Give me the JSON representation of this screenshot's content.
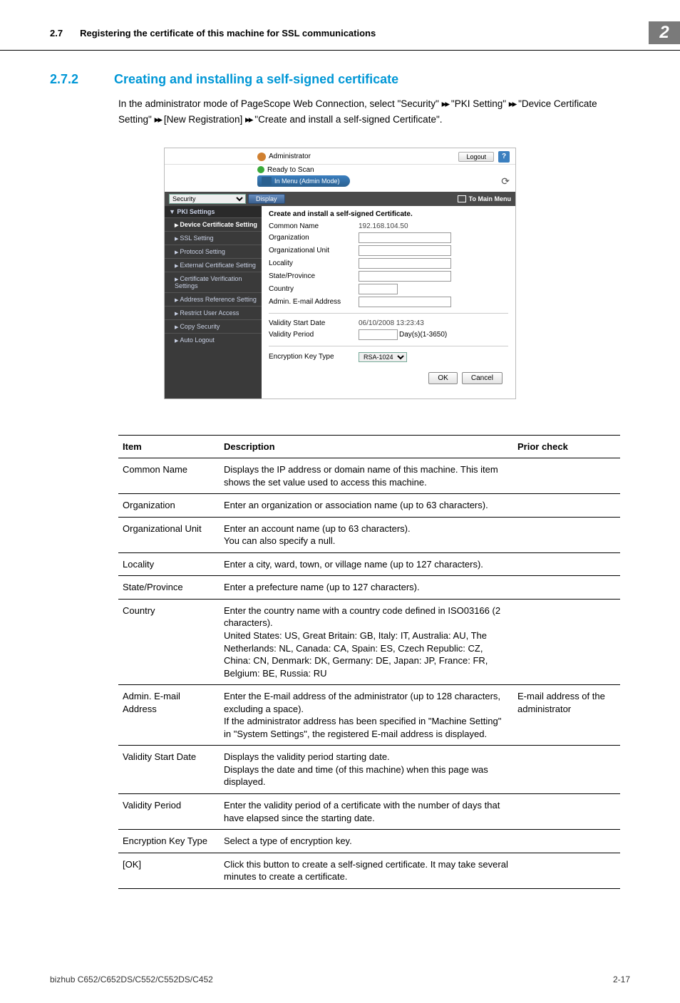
{
  "header": {
    "section_num": "2.7",
    "section_title": "Registering the certificate of this machine for SSL communications",
    "chip": "2"
  },
  "heading": {
    "num": "2.7.2",
    "title": "Creating and installing a self-signed certificate"
  },
  "intro": {
    "l1a": "In the administrator mode of PageScope Web Connection, select \"Security\" ",
    "l1b": " \"PKI Setting\" ",
    "l1c": " \"Device Certificate Setting\" ",
    "l1d": " [New Registration] ",
    "l1e": " \"Create and install a self-signed Certificate\"."
  },
  "ss": {
    "admin": "Administrator",
    "logout": "Logout",
    "help": "?",
    "ready": "Ready to Scan",
    "mode": "In Menu (Admin Mode)",
    "refresh": "⟳",
    "select": "Security",
    "display": "Display",
    "mainmenu": "To Main Menu",
    "side": {
      "g1": "▼ PKI Settings",
      "i1": "Device Certificate Setting",
      "i2": "SSL Setting",
      "i3": "Protocol Setting",
      "i4": "External Certificate Setting",
      "g2": "Certificate Verification Settings",
      "g3": "Address Reference Setting",
      "g4": "Restrict User Access",
      "g5": "Copy Security",
      "g6": "Auto Logout"
    },
    "main": {
      "title": "Create and install a self-signed Certificate.",
      "common": "Common Name",
      "common_val": "192.168.104.50",
      "org": "Organization",
      "orgunit": "Organizational Unit",
      "locality": "Locality",
      "state": "State/Province",
      "country": "Country",
      "email": "Admin. E-mail Address",
      "vstart": "Validity Start Date",
      "vstart_val": "06/10/2008 13:23:43",
      "vperiod": "Validity Period",
      "vperiod_suffix": "Day(s)(1-3650)",
      "enc": "Encryption Key Type",
      "enc_val": "RSA-1024",
      "ok": "OK",
      "cancel": "Cancel"
    }
  },
  "table": {
    "h1": "Item",
    "h2": "Description",
    "h3": "Prior check",
    "rows": [
      {
        "item": "Common Name",
        "desc": "Displays the IP address or domain name of this machine. This item shows the set value used to access this machine.",
        "prior": ""
      },
      {
        "item": "Organization",
        "desc": "Enter an organization or association name (up to 63 characters).",
        "prior": ""
      },
      {
        "item": "Organizational Unit",
        "desc": "Enter an account name (up to 63 characters).\nYou can also specify a null.",
        "prior": ""
      },
      {
        "item": "Locality",
        "desc": "Enter a city, ward, town, or village name (up to 127 characters).",
        "prior": ""
      },
      {
        "item": "State/Province",
        "desc": "Enter a prefecture name (up to 127 characters).",
        "prior": ""
      },
      {
        "item": "Country",
        "desc": "Enter the country name with a country code defined in ISO03166 (2 characters).\nUnited States: US, Great Britain: GB, Italy: IT, Australia: AU, The Netherlands: NL, Canada: CA, Spain: ES, Czech Republic: CZ, China: CN, Denmark: DK, Germany: DE, Japan: JP, France: FR, Belgium: BE, Russia: RU",
        "prior": ""
      },
      {
        "item": "Admin. E-mail Address",
        "desc": "Enter the E-mail address of the administrator (up to 128 characters, excluding a space).\nIf the administrator address has been specified in \"Machine Setting\" in \"System Settings\", the registered E-mail address is displayed.",
        "prior": "E-mail address of the administrator"
      },
      {
        "item": "Validity Start Date",
        "desc": "Displays the validity period starting date.\nDisplays the date and time (of this machine) when this page was displayed.",
        "prior": ""
      },
      {
        "item": "Validity Period",
        "desc": "Enter the validity period of a certificate with the number of days that have elapsed since the starting date.",
        "prior": ""
      },
      {
        "item": "Encryption Key Type",
        "desc": "Select a type of encryption key.",
        "prior": ""
      },
      {
        "item": "[OK]",
        "desc": "Click this button to create a self-signed certificate. It may take several minutes to create a certificate.",
        "prior": ""
      }
    ]
  },
  "footer": {
    "model": "bizhub C652/C652DS/C552/C552DS/C452",
    "page": "2-17"
  }
}
